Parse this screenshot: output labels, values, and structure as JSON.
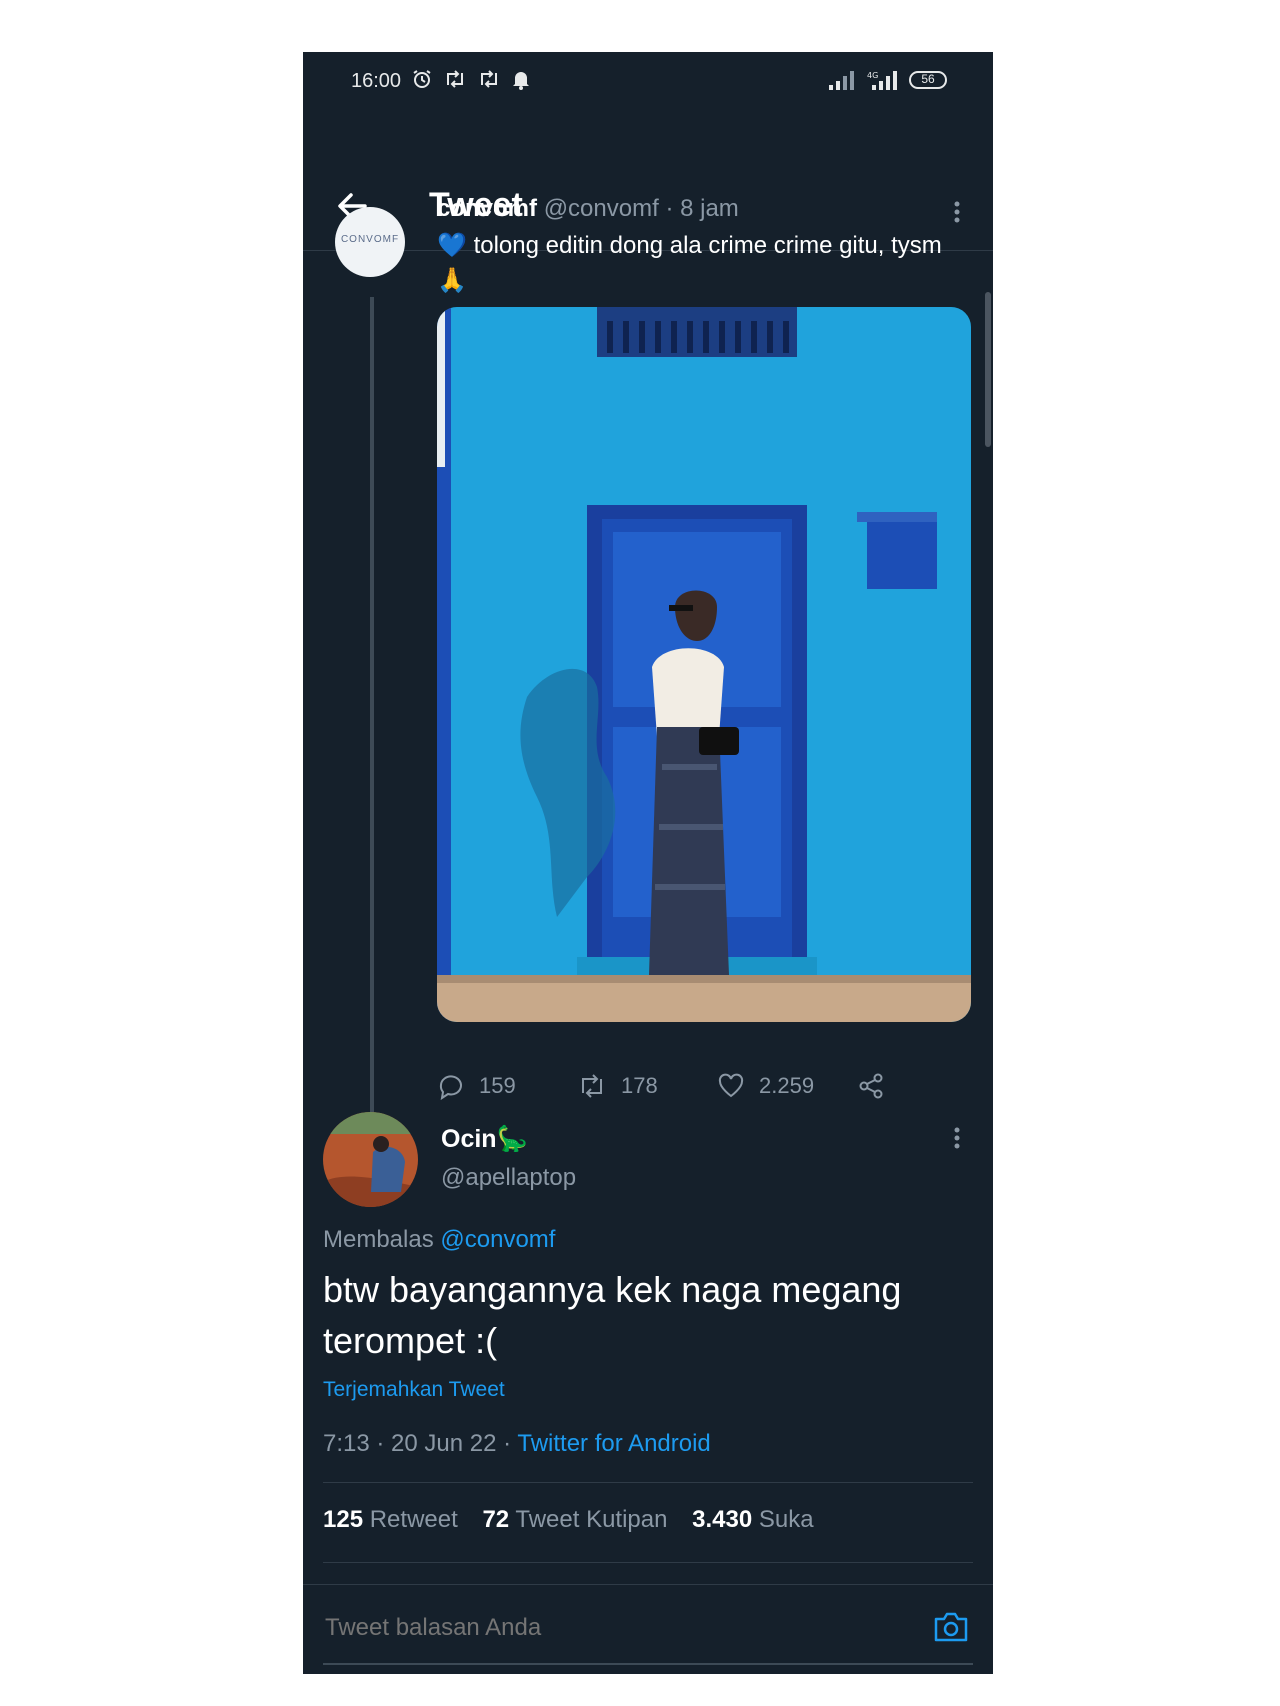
{
  "status_bar": {
    "time": "16:00",
    "battery": "56"
  },
  "header": {
    "title": "Tweet"
  },
  "original_tweet": {
    "author_name": "convomf",
    "author_handle": "@convomf",
    "separator": "·",
    "time_ago": "8 jam",
    "avatar_text": "CONVOMF",
    "text": "tolong editin dong ala crime crime gitu, tysm",
    "emoji_heart": "💙",
    "emoji_pray": "🙏",
    "replies": "159",
    "retweets": "178",
    "likes": "2.259"
  },
  "reply_tweet": {
    "author_name": "Ocin",
    "author_emoji": "🦕",
    "author_handle": "@apellaptop",
    "replying_prefix": "Membalas",
    "replying_to": "@convomf",
    "text": "btw bayangannya kek naga megang terompet :(",
    "translate_label": "Terjemahkan Tweet",
    "timestamp": "7:13 · 20 Jun 22 ·",
    "source": "Twitter for Android",
    "stats": {
      "retweets": "125",
      "retweets_label": "Retweet",
      "quotes": "72",
      "quotes_label": "Tweet Kutipan",
      "likes": "3.430",
      "likes_label": "Suka"
    }
  },
  "composer": {
    "placeholder": "Tweet balasan Anda"
  },
  "colors": {
    "background": "#15202b",
    "accent": "#1d9bf0",
    "secondary_text": "#8b98a5",
    "photo_wall": "#22a7e0",
    "photo_door": "#1c4eb6"
  }
}
